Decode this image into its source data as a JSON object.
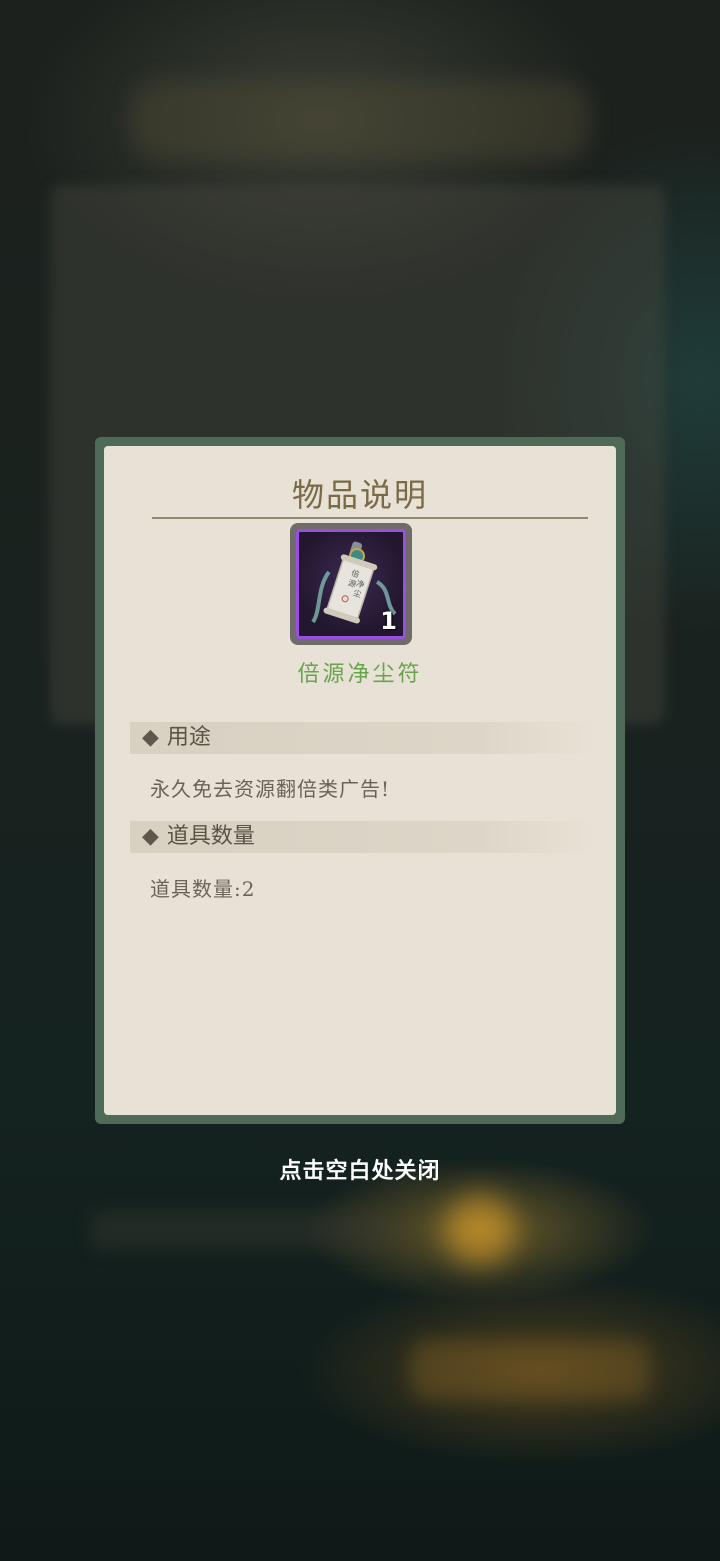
{
  "modal": {
    "title": "物品说明",
    "item": {
      "name": "倍源净尘符",
      "count": "1",
      "scroll_text": "倍源净尘",
      "icon": "talisman-scroll-icon"
    },
    "sections": [
      {
        "header": "用途",
        "body": "永久免去资源翻倍类广告!"
      },
      {
        "header": "道具数量",
        "body": "道具数量:2"
      }
    ],
    "diamond": "◆"
  },
  "close_hint": "点击空白处关闭",
  "colors": {
    "frame": "#4f6b57",
    "panel": "#e8e2d6",
    "title": "#7a6a45",
    "item_name": "#6aa24f",
    "rarity_border": "#9b4fe0"
  }
}
